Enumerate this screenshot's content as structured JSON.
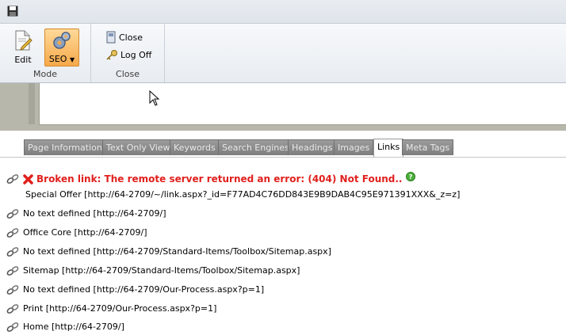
{
  "qat": {
    "save_icon": "save-icon"
  },
  "ribbon": {
    "mode_group": {
      "label": "Mode",
      "edit_label": "Edit",
      "seo_label": "SEO"
    },
    "close_group": {
      "label": "Close",
      "close_label": "Close",
      "logoff_label": "Log Off"
    }
  },
  "tabs": [
    {
      "label": "Page Information"
    },
    {
      "label": "Text Only View"
    },
    {
      "label": "Keywords"
    },
    {
      "label": "Search Engines"
    },
    {
      "label": "Headings"
    },
    {
      "label": "Images"
    },
    {
      "label": "Links",
      "active": true
    },
    {
      "label": "Meta Tags"
    }
  ],
  "broken_link": {
    "message": "Broken link: The remote server returned an error: (404) Not Found..",
    "detail": "Special Offer [http://64-2709/~/link.aspx?_id=F77AD4C76DD843E9B9DAB4C95E971391XXX&_z=z]"
  },
  "links": [
    "No text defined [http://64-2709/]",
    "Office Core [http://64-2709/]",
    "No text defined [http://64-2709/Standard-Items/Toolbox/Sitemap.aspx]",
    "Sitemap [http://64-2709/Standard-Items/Toolbox/Sitemap.aspx]",
    "No text defined [http://64-2709/Our-Process.aspx?p=1]",
    "Print [http://64-2709/Our-Process.aspx?p=1]",
    "Home [http://64-2709/]"
  ],
  "colors": {
    "broken": "#e0201d",
    "seo_active": "#f6a94a",
    "tab_bg": "#8a8a8a"
  }
}
